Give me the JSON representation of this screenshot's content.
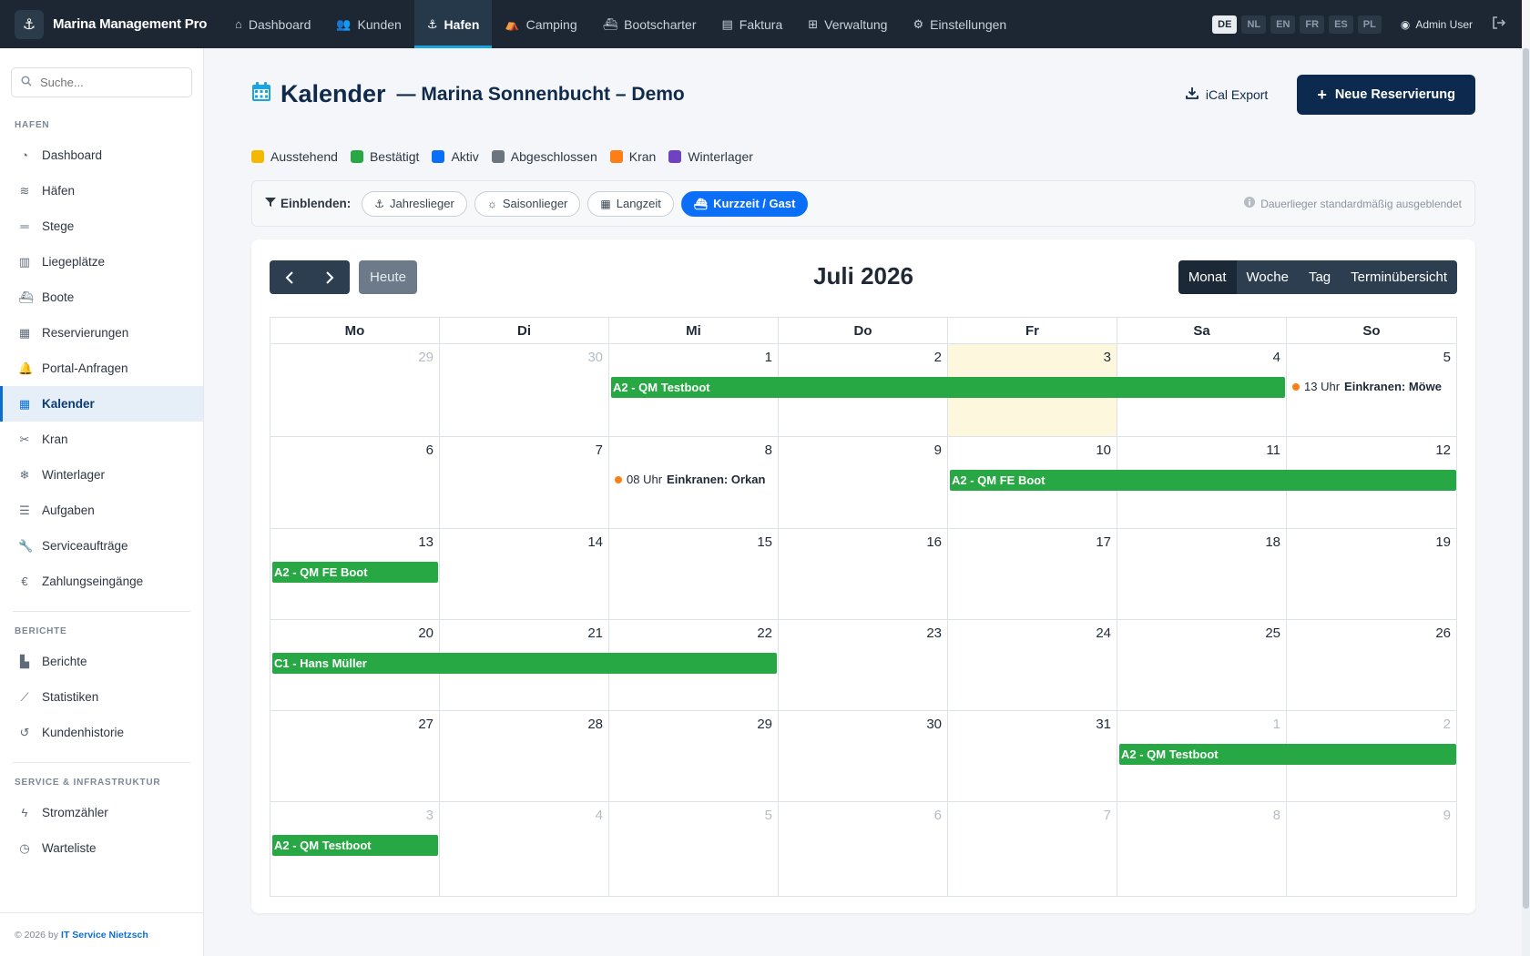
{
  "app": {
    "title": "Marina Management Pro"
  },
  "nav": {
    "items": [
      {
        "label": "Dashboard",
        "icon": "house-icon"
      },
      {
        "label": "Kunden",
        "icon": "users-icon"
      },
      {
        "label": "Hafen",
        "icon": "anchor-icon",
        "active": true
      },
      {
        "label": "Camping",
        "icon": "tent-icon"
      },
      {
        "label": "Bootscharter",
        "icon": "ship-icon"
      },
      {
        "label": "Faktura",
        "icon": "file-icon"
      },
      {
        "label": "Verwaltung",
        "icon": "grid-icon"
      },
      {
        "label": "Einstellungen",
        "icon": "gear-icon"
      }
    ],
    "languages": [
      "DE",
      "NL",
      "EN",
      "FR",
      "ES",
      "PL"
    ],
    "active_language": "DE",
    "user": "Admin User"
  },
  "sidebar": {
    "search_placeholder": "Suche...",
    "sections": [
      {
        "title": "HAFEN",
        "items": [
          {
            "label": "Dashboard",
            "icon": "gauge-icon"
          },
          {
            "label": "Häfen",
            "icon": "water-icon"
          },
          {
            "label": "Stege",
            "icon": "bars-icon"
          },
          {
            "label": "Liegeplätze",
            "icon": "map-icon"
          },
          {
            "label": "Boote",
            "icon": "ship-icon"
          },
          {
            "label": "Reservierungen",
            "icon": "calendar-check-icon"
          },
          {
            "label": "Portal-Anfragen",
            "icon": "bell-icon"
          },
          {
            "label": "Kalender",
            "icon": "calendar-icon",
            "active": true
          },
          {
            "label": "Kran",
            "icon": "crane-icon"
          },
          {
            "label": "Winterlager",
            "icon": "snowflake-icon"
          },
          {
            "label": "Aufgaben",
            "icon": "list-check-icon"
          },
          {
            "label": "Serviceaufträge",
            "icon": "wrench-icon"
          },
          {
            "label": "Zahlungseingänge",
            "icon": "euro-icon"
          }
        ]
      },
      {
        "title": "BERICHTE",
        "items": [
          {
            "label": "Berichte",
            "icon": "chart-bar-icon"
          },
          {
            "label": "Statistiken",
            "icon": "chart-line-icon"
          },
          {
            "label": "Kundenhistorie",
            "icon": "history-icon"
          }
        ]
      },
      {
        "title": "SERVICE & INFRASTRUKTUR",
        "items": [
          {
            "label": "Stromzähler",
            "icon": "bolt-icon"
          },
          {
            "label": "Warteliste",
            "icon": "clock-icon"
          }
        ]
      }
    ],
    "footer_prefix": "© 2026 by",
    "footer_link": "IT Service Nietzsch"
  },
  "page": {
    "title": "Kalender",
    "subtitle": "— Marina Sonnenbucht – Demo",
    "ical_label": "iCal Export",
    "new_label": "Neue Reservierung"
  },
  "legend": [
    {
      "label": "Ausstehend",
      "color": "#f5b800"
    },
    {
      "label": "Bestätigt",
      "color": "#28a745"
    },
    {
      "label": "Aktiv",
      "color": "#0b6ef6"
    },
    {
      "label": "Abgeschlossen",
      "color": "#6c757d"
    },
    {
      "label": "Kran",
      "color": "#fd7e14"
    },
    {
      "label": "Winterlager",
      "color": "#6f42c1"
    }
  ],
  "filter": {
    "label": "Einblenden:",
    "chips": [
      {
        "label": "Jahreslieger",
        "icon": "anchor-icon",
        "active": false
      },
      {
        "label": "Saisonlieger",
        "icon": "sun-icon",
        "active": false
      },
      {
        "label": "Langzeit",
        "icon": "calendar-icon",
        "active": false
      },
      {
        "label": "Kurzzeit / Gast",
        "icon": "ship-icon",
        "active": true
      }
    ],
    "info": "Dauerlieger standardmäßig ausgeblendet"
  },
  "calendar": {
    "month_title": "Juli 2026",
    "today_label": "Heute",
    "views": [
      {
        "label": "Monat",
        "active": true
      },
      {
        "label": "Woche",
        "active": false
      },
      {
        "label": "Tag",
        "active": false
      },
      {
        "label": "Terminübersicht",
        "active": false
      }
    ],
    "weekdays": [
      "Mo",
      "Di",
      "Mi",
      "Do",
      "Fr",
      "Sa",
      "So"
    ],
    "weeks": [
      [
        {
          "d": "29",
          "o": true
        },
        {
          "d": "30",
          "o": true
        },
        {
          "d": "1"
        },
        {
          "d": "2"
        },
        {
          "d": "3",
          "today": true
        },
        {
          "d": "4"
        },
        {
          "d": "5"
        }
      ],
      [
        {
          "d": "6"
        },
        {
          "d": "7"
        },
        {
          "d": "8"
        },
        {
          "d": "9"
        },
        {
          "d": "10"
        },
        {
          "d": "11"
        },
        {
          "d": "12"
        }
      ],
      [
        {
          "d": "13"
        },
        {
          "d": "14"
        },
        {
          "d": "15"
        },
        {
          "d": "16"
        },
        {
          "d": "17"
        },
        {
          "d": "18"
        },
        {
          "d": "19"
        }
      ],
      [
        {
          "d": "20"
        },
        {
          "d": "21"
        },
        {
          "d": "22"
        },
        {
          "d": "23"
        },
        {
          "d": "24"
        },
        {
          "d": "25"
        },
        {
          "d": "26"
        }
      ],
      [
        {
          "d": "27"
        },
        {
          "d": "28"
        },
        {
          "d": "29"
        },
        {
          "d": "30"
        },
        {
          "d": "31"
        },
        {
          "d": "1",
          "o": true
        },
        {
          "d": "2",
          "o": true
        }
      ],
      [
        {
          "d": "3",
          "o": true
        },
        {
          "d": "4",
          "o": true
        },
        {
          "d": "5",
          "o": true
        },
        {
          "d": "6",
          "o": true
        },
        {
          "d": "7",
          "o": true
        },
        {
          "d": "8",
          "o": true
        },
        {
          "d": "9",
          "o": true
        }
      ]
    ],
    "events": [
      {
        "label": "A2 - QM Testboot",
        "week": 0,
        "start": 2,
        "end": 5,
        "color": "#28a745"
      },
      {
        "label": "A2 - QM FE Boot",
        "week": 1,
        "start": 4,
        "end": 6,
        "color": "#28a745",
        "continues": true
      },
      {
        "label": "A2 - QM FE Boot",
        "week": 2,
        "start": 0,
        "end": 0,
        "color": "#28a745"
      },
      {
        "label": "C1 - Hans Müller",
        "week": 3,
        "start": 0,
        "end": 2,
        "color": "#28a745"
      },
      {
        "label": "A2 - QM Testboot",
        "week": 4,
        "start": 5,
        "end": 6,
        "color": "#28a745",
        "continues": true
      },
      {
        "label": "A2 - QM Testboot",
        "week": 5,
        "start": 0,
        "end": 0,
        "color": "#28a745"
      }
    ],
    "dot_events": [
      {
        "time": "13 Uhr",
        "title": "Einkranen: Möwe",
        "week": 0,
        "day": 6
      },
      {
        "time": "08 Uhr",
        "title": "Einkranen: Orkan",
        "week": 1,
        "day": 2
      }
    ]
  }
}
